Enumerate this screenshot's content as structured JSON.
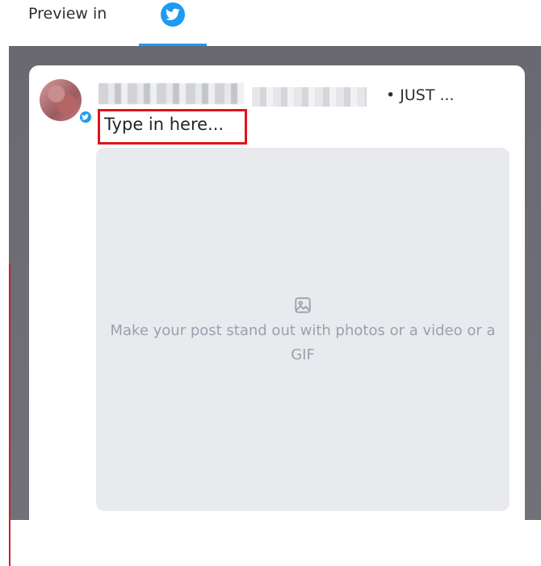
{
  "tabs": {
    "preview_label": "Preview in",
    "active_network_icon": "twitter-bird-icon"
  },
  "post": {
    "timestamp": "• JUST ...",
    "compose_placeholder": "Type in here...",
    "media_prompt": "Make your post stand out with photos or a video or a GIF",
    "media_icon": "image-icon"
  },
  "colors": {
    "twitter_blue": "#1d9bf0",
    "highlight_red": "#e0141b",
    "backdrop": "#6d6b73"
  }
}
